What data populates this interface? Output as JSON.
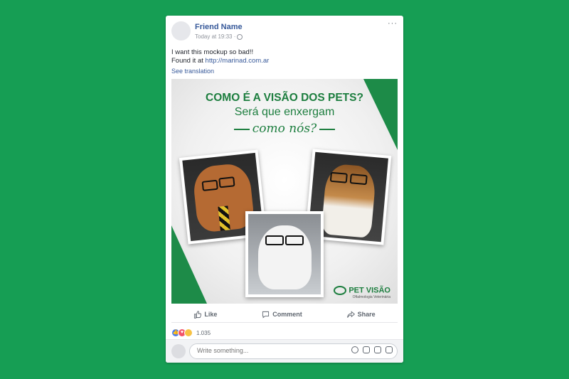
{
  "post": {
    "author": "Friend Name",
    "timestamp": "Today at 19:33 ·",
    "text_line1": "I want this mockup so bad!!",
    "text_line2_prefix": "Found it at ",
    "link": "http://marinad.com.ar",
    "see_translation": "See translation",
    "more": "···"
  },
  "image": {
    "headline": "COMO É A VISÃO DOS PETS?",
    "subheadline": "Será que enxergam",
    "tagline": "como nós?",
    "brand": "PET VISÃO",
    "brand_sub": "Oftalmologia Veterinária"
  },
  "actions": {
    "like": "Like",
    "comment": "Comment",
    "share": "Share"
  },
  "reactions": {
    "count": "1.035"
  },
  "comment_box": {
    "placeholder": "Write something..."
  },
  "colors": {
    "background": "#169e54",
    "link": "#365899",
    "brand_green": "#1d7e3f"
  }
}
